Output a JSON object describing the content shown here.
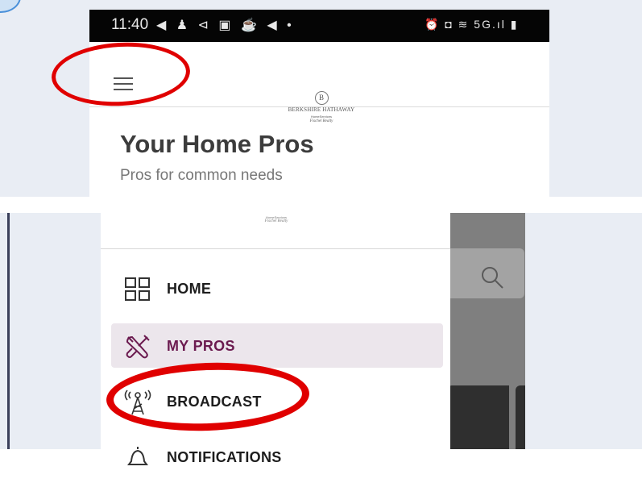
{
  "status_bar": {
    "time": "11:40",
    "left_icons": "◀ ♟ ⊲ ▣ ☕ ◀ •",
    "right_icons": "⏰ ◘ ≋ 5G.ıl ▮"
  },
  "app_bar": {
    "logo_name": "BERKSHIRE HATHAWAY",
    "logo_sub": "HomeServices",
    "logo_franchise": "Fischel Realty"
  },
  "page": {
    "title": "Your Home Pros",
    "subtitle": "Pros for common needs"
  },
  "drawer": {
    "logo_sub": "HomeServices",
    "logo_franchise": "Fischel Realty",
    "items": [
      {
        "label": "HOME",
        "icon": "grid-icon",
        "active": false
      },
      {
        "label": "MY PROS",
        "icon": "tools-icon",
        "active": true
      },
      {
        "label": "BROADCAST",
        "icon": "broadcast-tower-icon",
        "active": false
      },
      {
        "label": "NOTIFICATIONS",
        "icon": "bell-icon",
        "active": false
      }
    ]
  },
  "colors": {
    "accent": "#6b1a4f",
    "highlight_annotation": "#e00000",
    "active_item_bg": "#ece6ec",
    "status_bar_bg": "#050505"
  }
}
